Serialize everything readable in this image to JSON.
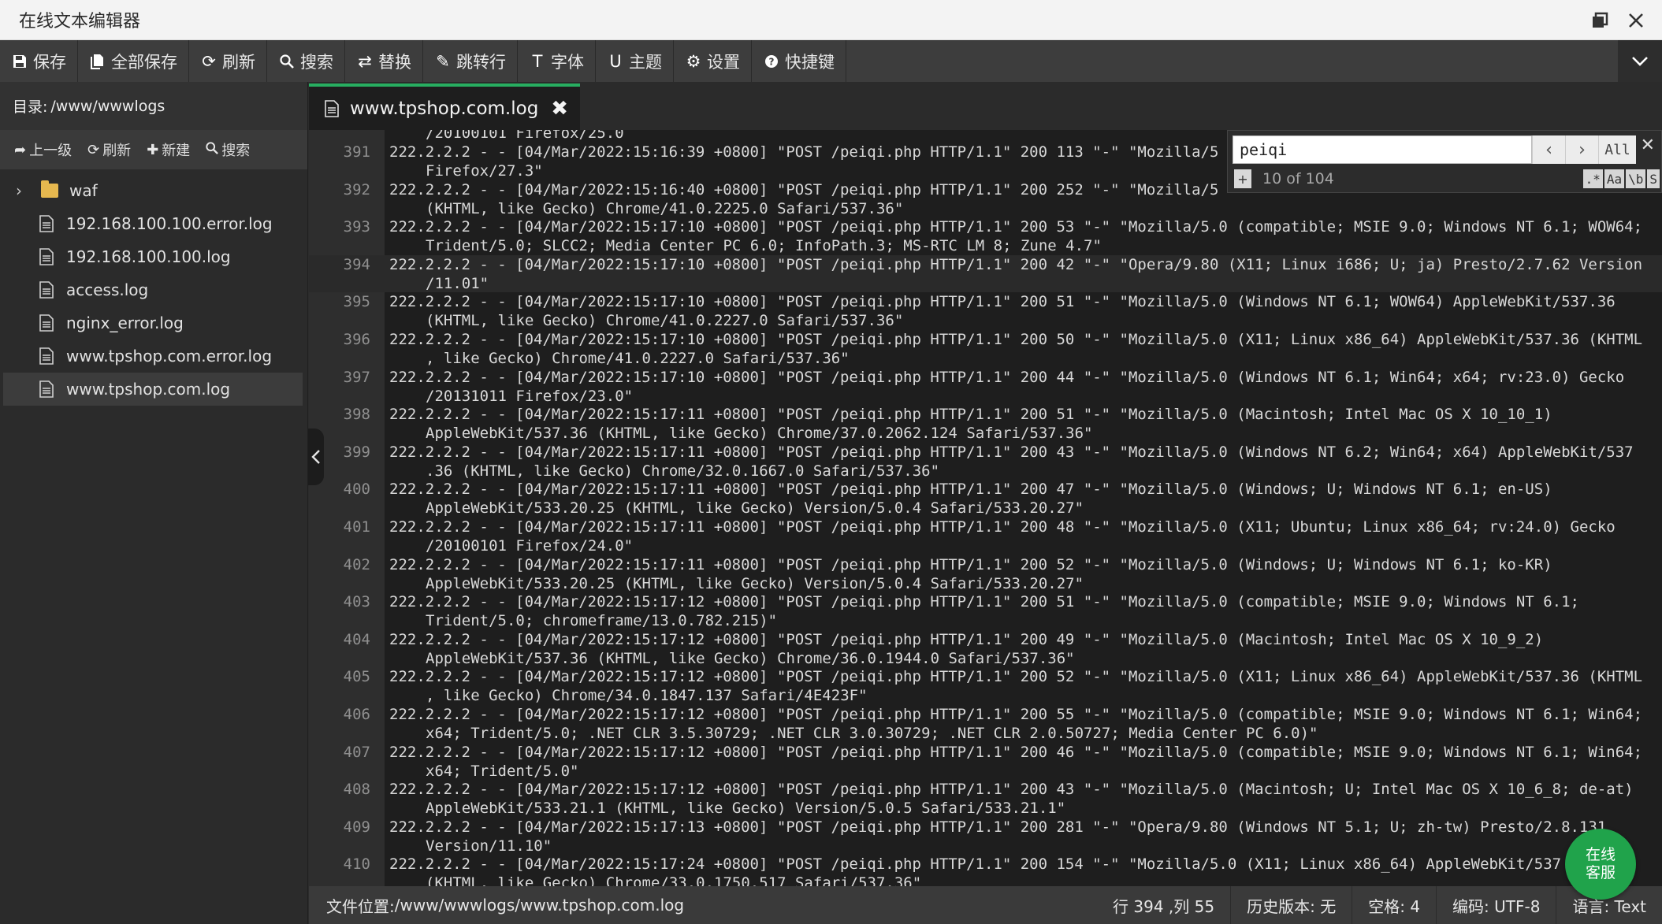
{
  "app": {
    "title": "在线文本编辑器"
  },
  "toolbar": {
    "items": [
      {
        "label": "保存",
        "icon": "save-icon"
      },
      {
        "label": "全部保存",
        "icon": "save-all-icon"
      },
      {
        "label": "刷新",
        "icon": "refresh-icon"
      },
      {
        "label": "搜索",
        "icon": "search-icon"
      },
      {
        "label": "替换",
        "icon": "replace-icon"
      },
      {
        "label": "跳转行",
        "icon": "goto-line-icon"
      },
      {
        "label": "字体",
        "icon": "font-icon"
      },
      {
        "label": "主题",
        "icon": "theme-icon"
      },
      {
        "label": "设置",
        "icon": "gear-icon"
      },
      {
        "label": "快捷键",
        "icon": "help-icon"
      }
    ]
  },
  "sidebar": {
    "dir_label": "目录:",
    "dir_path": "/www/wwwlogs",
    "ops": [
      {
        "label": "上一级",
        "icon": "up-level-icon"
      },
      {
        "label": "刷新",
        "icon": "refresh-icon"
      },
      {
        "label": "新建",
        "icon": "plus-icon"
      },
      {
        "label": "搜索",
        "icon": "search-icon"
      }
    ],
    "folder": "waf",
    "files": [
      "192.168.100.100.error.log",
      "192.168.100.100.log",
      "access.log",
      "nginx_error.log",
      "www.tpshop.com.error.log",
      "www.tpshop.com.log"
    ],
    "active_file": "www.tpshop.com.log"
  },
  "tab": {
    "label": "www.tpshop.com.log",
    "close": "✖"
  },
  "editor": {
    "partial_top": "/20100101 Firefox/25.0",
    "lines": [
      {
        "n": "391",
        "a": "222.2.2.2 - - [04/Mar/2022:15:16:39 +0800] \"POST /peiqi.php HTTP/1.1\" 200 113 \"-\" \"Mozilla/5",
        "b": "Firefox/27.3\""
      },
      {
        "n": "392",
        "a": "222.2.2.2 - - [04/Mar/2022:15:16:40 +0800] \"POST /peiqi.php HTTP/1.1\" 200 252 \"-\" \"Mozilla/5",
        "b": "(KHTML, like Gecko) Chrome/41.0.2225.0 Safari/537.36\""
      },
      {
        "n": "393",
        "a": "222.2.2.2 - - [04/Mar/2022:15:17:10 +0800] \"POST /peiqi.php HTTP/1.1\" 200 53 \"-\" \"Mozilla/5.0 (compatible; MSIE 9.0; Windows NT 6.1; WOW64;",
        "b": "Trident/5.0; SLCC2; Media Center PC 6.0; InfoPath.3; MS-RTC LM 8; Zune 4.7\""
      },
      {
        "n": "394",
        "a": "222.2.2.2 - - [04/Mar/2022:15:17:10 +0800] \"POST /peiqi.php HTTP/1.1\" 200 42 \"-\" \"Opera/9.80 (X11; Linux i686; U; ja) Presto/2.7.62 Version",
        "b": "/11.01\""
      },
      {
        "n": "395",
        "a": "222.2.2.2 - - [04/Mar/2022:15:17:10 +0800] \"POST /peiqi.php HTTP/1.1\" 200 51 \"-\" \"Mozilla/5.0 (Windows NT 6.1; WOW64) AppleWebKit/537.36",
        "b": "(KHTML, like Gecko) Chrome/41.0.2227.0 Safari/537.36\""
      },
      {
        "n": "396",
        "a": "222.2.2.2 - - [04/Mar/2022:15:17:10 +0800] \"POST /peiqi.php HTTP/1.1\" 200 50 \"-\" \"Mozilla/5.0 (X11; Linux x86_64) AppleWebKit/537.36 (KHTML",
        "b": ", like Gecko) Chrome/41.0.2227.0 Safari/537.36\""
      },
      {
        "n": "397",
        "a": "222.2.2.2 - - [04/Mar/2022:15:17:10 +0800] \"POST /peiqi.php HTTP/1.1\" 200 44 \"-\" \"Mozilla/5.0 (Windows NT 6.1; Win64; x64; rv:23.0) Gecko",
        "b": "/20131011 Firefox/23.0\""
      },
      {
        "n": "398",
        "a": "222.2.2.2 - - [04/Mar/2022:15:17:11 +0800] \"POST /peiqi.php HTTP/1.1\" 200 51 \"-\" \"Mozilla/5.0 (Macintosh; Intel Mac OS X 10_10_1)",
        "b": "AppleWebKit/537.36 (KHTML, like Gecko) Chrome/37.0.2062.124 Safari/537.36\""
      },
      {
        "n": "399",
        "a": "222.2.2.2 - - [04/Mar/2022:15:17:11 +0800] \"POST /peiqi.php HTTP/1.1\" 200 43 \"-\" \"Mozilla/5.0 (Windows NT 6.2; Win64; x64) AppleWebKit/537",
        "b": ".36 (KHTML, like Gecko) Chrome/32.0.1667.0 Safari/537.36\""
      },
      {
        "n": "400",
        "a": "222.2.2.2 - - [04/Mar/2022:15:17:11 +0800] \"POST /peiqi.php HTTP/1.1\" 200 47 \"-\" \"Mozilla/5.0 (Windows; U; Windows NT 6.1; en-US)",
        "b": "AppleWebKit/533.20.25 (KHTML, like Gecko) Version/5.0.4 Safari/533.20.27\""
      },
      {
        "n": "401",
        "a": "222.2.2.2 - - [04/Mar/2022:15:17:11 +0800] \"POST /peiqi.php HTTP/1.1\" 200 48 \"-\" \"Mozilla/5.0 (X11; Ubuntu; Linux x86_64; rv:24.0) Gecko",
        "b": "/20100101 Firefox/24.0\""
      },
      {
        "n": "402",
        "a": "222.2.2.2 - - [04/Mar/2022:15:17:11 +0800] \"POST /peiqi.php HTTP/1.1\" 200 52 \"-\" \"Mozilla/5.0 (Windows; U; Windows NT 6.1; ko-KR)",
        "b": "AppleWebKit/533.20.25 (KHTML, like Gecko) Version/5.0.4 Safari/533.20.27\""
      },
      {
        "n": "403",
        "a": "222.2.2.2 - - [04/Mar/2022:15:17:12 +0800] \"POST /peiqi.php HTTP/1.1\" 200 51 \"-\" \"Mozilla/5.0 (compatible; MSIE 9.0; Windows NT 6.1;",
        "b": "Trident/5.0; chromeframe/13.0.782.215)\""
      },
      {
        "n": "404",
        "a": "222.2.2.2 - - [04/Mar/2022:15:17:12 +0800] \"POST /peiqi.php HTTP/1.1\" 200 49 \"-\" \"Mozilla/5.0 (Macintosh; Intel Mac OS X 10_9_2)",
        "b": "AppleWebKit/537.36 (KHTML, like Gecko) Chrome/36.0.1944.0 Safari/537.36\""
      },
      {
        "n": "405",
        "a": "222.2.2.2 - - [04/Mar/2022:15:17:12 +0800] \"POST /peiqi.php HTTP/1.1\" 200 52 \"-\" \"Mozilla/5.0 (X11; Linux x86_64) AppleWebKit/537.36 (KHTML",
        "b": ", like Gecko) Chrome/34.0.1847.137 Safari/4E423F\""
      },
      {
        "n": "406",
        "a": "222.2.2.2 - - [04/Mar/2022:15:17:12 +0800] \"POST /peiqi.php HTTP/1.1\" 200 55 \"-\" \"Mozilla/5.0 (compatible; MSIE 9.0; Windows NT 6.1; Win64;",
        "b": "x64; Trident/5.0; .NET CLR 3.5.30729; .NET CLR 3.0.30729; .NET CLR 2.0.50727; Media Center PC 6.0)\""
      },
      {
        "n": "407",
        "a": "222.2.2.2 - - [04/Mar/2022:15:17:12 +0800] \"POST /peiqi.php HTTP/1.1\" 200 46 \"-\" \"Mozilla/5.0 (compatible; MSIE 9.0; Windows NT 6.1; Win64;",
        "b": "x64; Trident/5.0\""
      },
      {
        "n": "408",
        "a": "222.2.2.2 - - [04/Mar/2022:15:17:12 +0800] \"POST /peiqi.php HTTP/1.1\" 200 43 \"-\" \"Mozilla/5.0 (Macintosh; U; Intel Mac OS X 10_6_8; de-at)",
        "b": "AppleWebKit/533.21.1 (KHTML, like Gecko) Version/5.0.5 Safari/533.21.1\""
      },
      {
        "n": "409",
        "a": "222.2.2.2 - - [04/Mar/2022:15:17:13 +0800] \"POST /peiqi.php HTTP/1.1\" 200 281 \"-\" \"Opera/9.80 (Windows NT 5.1; U; zh-tw) Presto/2.8.131",
        "b": "Version/11.10\""
      },
      {
        "n": "410",
        "a": "222.2.2.2 - - [04/Mar/2022:15:17:24 +0800] \"POST /peiqi.php HTTP/1.1\" 200 154 \"-\" \"Mozilla/5.0 (X11; Linux x86_64) AppleWebKit/537",
        "b": "(KHTML, like Gecko) Chrome/33.0.1750.517 Safari/537.36\""
      }
    ]
  },
  "search": {
    "value": "peiqi",
    "prev": "‹",
    "next": "›",
    "all": "All",
    "close": "✕",
    "plus": "+",
    "count": "10 of 104",
    "opt_regex": ".*",
    "opt_case": "Aa",
    "opt_word": "\\b",
    "opt_selection": "S"
  },
  "status": {
    "file_position_label": "文件位置:",
    "file_position": "/www/wwwlogs/www.tpshop.com.log",
    "cursor": "行 394 ,列 55",
    "history": "历史版本: 无",
    "indent": "空格: 4",
    "encoding": "编码: UTF-8",
    "language": "语言: Text"
  },
  "service": {
    "line1": "在线",
    "line2": "客服"
  },
  "colors": {
    "accent": "#27ae60",
    "service": "#20a34b"
  }
}
